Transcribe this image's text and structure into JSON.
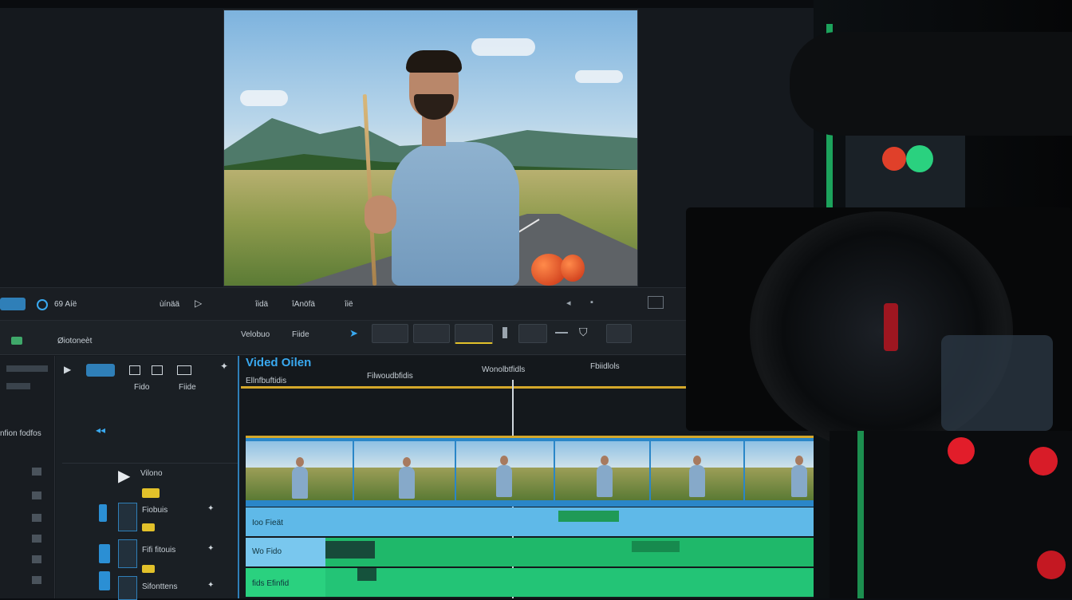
{
  "transport": {
    "left_label_1": "69 Aíë",
    "left_label_2": "ùínää",
    "mid_label_1": "îidä",
    "mid_label_2": "îAnöfä",
    "mid_label_3": "îië"
  },
  "toolbar": {
    "section_label": "Øiotoneèt",
    "tab_1": "Velobuo",
    "tab_2": "Fiide"
  },
  "panel_b": {
    "header_1": "Fido",
    "header_2": "Fiide",
    "item_1": "Vilono",
    "item_2": "Fiobuis",
    "item_3": "Fifi fitouis",
    "item_4": "Sifonttens"
  },
  "panel_a": {
    "label": "nfion fodfos"
  },
  "timeline": {
    "title": "Vided Oilen",
    "subtitle": "Ellnfbuftidis",
    "ruler_1": "Filwoudbfidis",
    "ruler_2": "Wonolbtfidls",
    "ruler_3": "Fbiidlols",
    "track_blue_label": "Ioo Fieät",
    "track_green1_label": "Wo Fido",
    "track_green2_label": "fids Efinfid"
  },
  "colors": {
    "accent_blue": "#2f7fb8",
    "accent_gold": "#d4a72a",
    "track_green": "#1fb86a",
    "track_light_blue": "#5fb9e8"
  }
}
